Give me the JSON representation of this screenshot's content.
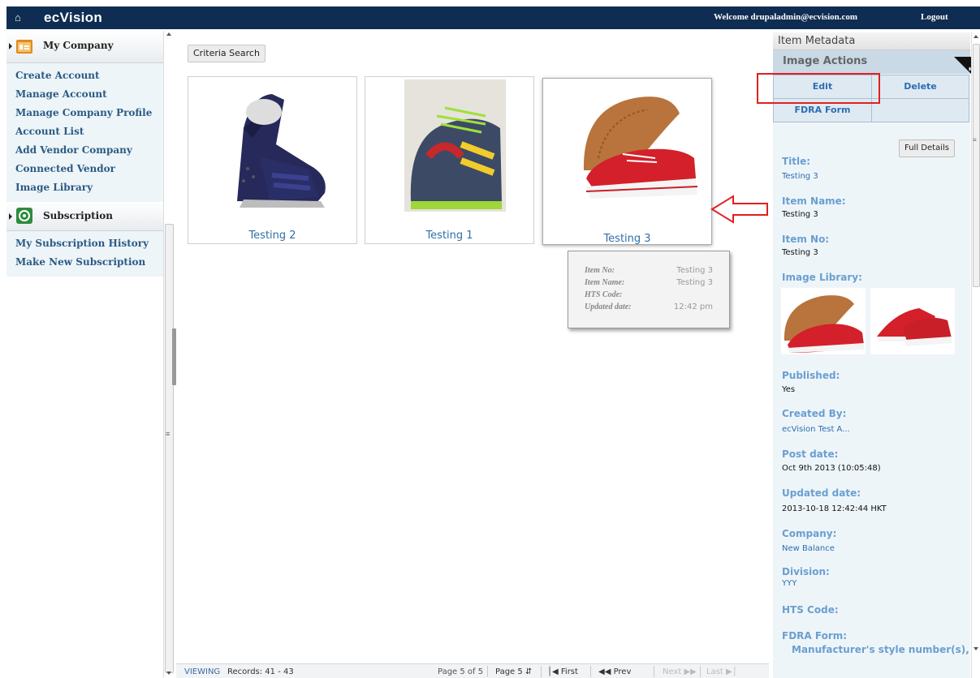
{
  "topbar": {
    "logo": "ecVision",
    "welcome": "Welcome drupaladmin@ecvision.com",
    "logout": "Logout"
  },
  "sidebar": {
    "section1_title": "My Company",
    "section1_items": [
      "Create Account",
      "Manage Account",
      "Manage Company Profile",
      "Account List",
      "Add Vendor Company",
      "Connected Vendor",
      "Image Library"
    ],
    "section2_title": "Subscription",
    "section2_items": [
      "My Subscription History",
      "Make New Subscription"
    ]
  },
  "center": {
    "criteria_button": "Criteria Search",
    "cards": [
      {
        "name": "Testing 2"
      },
      {
        "name": "Testing 1"
      },
      {
        "name": "Testing 3"
      }
    ],
    "tooltip": {
      "item_no_label": "Item No:",
      "item_no": "Testing 3",
      "item_name_label": "Item Name:",
      "item_name": "Testing 3",
      "hts_label": "HTS Code:",
      "hts": "",
      "updated_label": "Updated date:",
      "updated": "12:42 pm"
    }
  },
  "pager": {
    "viewing": "VIEWING",
    "records": "Records: 41 - 43",
    "page_of": "Page 5 of 5",
    "page_select": "Page 5",
    "first": "First",
    "prev": "Prev",
    "next": "Next",
    "last": "Last"
  },
  "right_panel": {
    "header": "Item Metadata",
    "actions_title": "Image Actions",
    "edit": "Edit",
    "delete": "Delete",
    "fdra_form_btn": "FDRA Form",
    "full_details": "Full Details",
    "fields": {
      "title_label": "Title:",
      "title": "Testing 3",
      "item_name_label": "Item Name:",
      "item_name": "Testing 3",
      "item_no_label": "Item No:",
      "item_no": "Testing 3",
      "library_label": "Image Library:",
      "published_label": "Published:",
      "published": "Yes",
      "created_by_label": "Created By:",
      "created_by": "ecVision Test A...",
      "post_date_label": "Post date:",
      "post_date": "Oct 9th 2013 (10:05:48)",
      "updated_label": "Updated date:",
      "updated": "2013-10-18 12:42:44 HKT",
      "company_label": "Company:",
      "company": "New Balance",
      "division_label": "Division:",
      "division": "YYY",
      "hts_label": "HTS Code:",
      "fdra_label": "FDRA Form:",
      "manufacturer_label": "Manufacturer's style number(s),"
    }
  },
  "colors": {
    "topbar": "#0f2d52",
    "link": "#2b6fb0",
    "annotation_red": "#e02020"
  },
  "icons": {
    "home": "home-icon",
    "company": "company-icon",
    "subscription": "subscription-icon",
    "wrench": "wrench-icon"
  }
}
